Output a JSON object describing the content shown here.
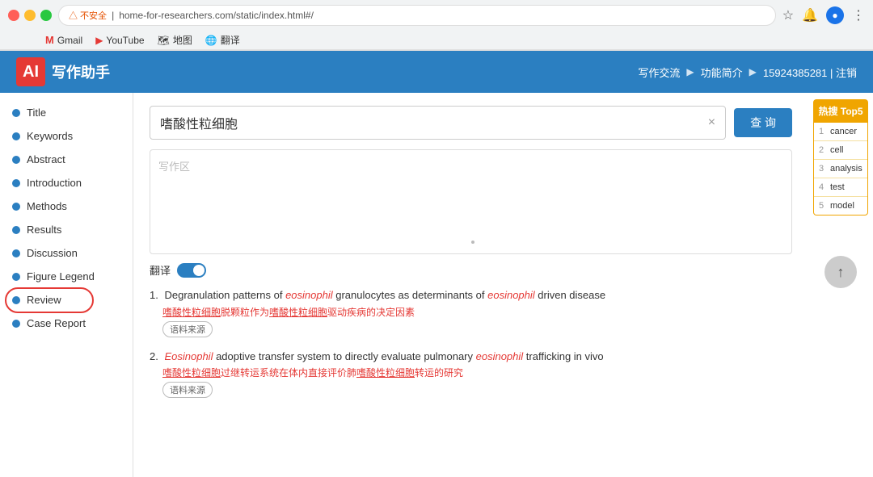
{
  "browser": {
    "address": "home-for-researchers.com/static/index.html#/",
    "warning_text": "△ 不安全",
    "bookmarks": [
      {
        "label": "Gmail",
        "icon": "G"
      },
      {
        "label": "YouTube",
        "icon": "▶"
      },
      {
        "label": "地图",
        "icon": "📍"
      },
      {
        "label": "翻译",
        "icon": "翻"
      }
    ]
  },
  "header": {
    "logo_text": "AI",
    "app_name": "写作助手",
    "nav_items": [
      "写作交流",
      "功能简介",
      "15924385281 | 注销"
    ]
  },
  "sidebar": {
    "items": [
      {
        "label": "Title",
        "active": false
      },
      {
        "label": "Keywords",
        "active": false
      },
      {
        "label": "Abstract",
        "active": false
      },
      {
        "label": "Introduction",
        "active": false
      },
      {
        "label": "Methods",
        "active": false
      },
      {
        "label": "Results",
        "active": false
      },
      {
        "label": "Discussion",
        "active": false
      },
      {
        "label": "Figure Legend",
        "active": false
      },
      {
        "label": "Review",
        "active": true,
        "highlight": true
      },
      {
        "label": "Case Report",
        "active": false
      }
    ]
  },
  "search": {
    "query": "嗜酸性粒细胞",
    "placeholder": "写作区",
    "btn_label": "查 询",
    "clear_icon": "×"
  },
  "hot_top5": {
    "title": "热搜 Top5",
    "items": [
      {
        "num": "1",
        "text": "cancer"
      },
      {
        "num": "2",
        "text": "cell"
      },
      {
        "num": "3",
        "text": "analysis"
      },
      {
        "num": "4",
        "text": "test"
      },
      {
        "num": "5",
        "text": "model"
      }
    ]
  },
  "translate_label": "翻译",
  "results": [
    {
      "num": "1.",
      "en_before": "Degranulation patterns of ",
      "keyword1": "eosinophil",
      "en_mid": " granulocytes as determinants of ",
      "keyword2": "eosinophil",
      "en_after": " driven disease",
      "zh_part1": "嗜酸性粒细胞",
      "zh_mid": "脱颗粒作为",
      "zh_part2": "嗜酸性粒细胞",
      "zh_after": "驱动疾病的决定因素",
      "source": "语料来源"
    },
    {
      "num": "2.",
      "en_before": "",
      "keyword1": "Eosinophil",
      "en_mid": " adoptive transfer system to directly evaluate pulmonary ",
      "keyword2": "eosinophil",
      "en_after": " trafficking in vivo",
      "zh_part1": "嗜酸性粒细胞",
      "zh_mid": "过继转运系统在体内直接评价肺",
      "zh_part2": "嗜酸性粒细胞",
      "zh_after": "转运的研究",
      "source": "语料来源"
    }
  ]
}
